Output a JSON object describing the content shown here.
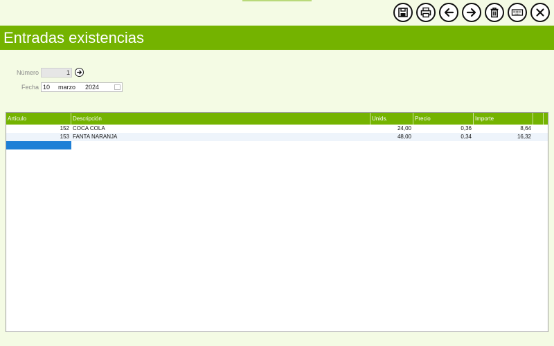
{
  "toolbar": {
    "buttons": [
      {
        "icon": "save-icon"
      },
      {
        "icon": "print-icon"
      },
      {
        "icon": "arrow-left-icon"
      },
      {
        "icon": "arrow-right-icon"
      },
      {
        "icon": "trash-icon"
      },
      {
        "icon": "keyboard-icon"
      },
      {
        "icon": "close-icon"
      }
    ]
  },
  "header": {
    "title": "Entradas existencias"
  },
  "form": {
    "numero_label": "Número",
    "numero_value": "1",
    "fecha_label": "Fecha",
    "fecha_day": "10",
    "fecha_month": "marzo",
    "fecha_year": "2024"
  },
  "grid": {
    "columns": [
      "Artículo",
      "Descripción",
      "Unids.",
      "Precio",
      "Importe"
    ],
    "rows": [
      {
        "articulo": "152",
        "descripcion": "COCA COLA",
        "unids": "24,00",
        "precio": "0,36",
        "importe": "8,64"
      },
      {
        "articulo": "153",
        "descripcion": "FANTA NARANJA",
        "unids": "48,00",
        "precio": "0,34",
        "importe": "16,32"
      }
    ]
  },
  "colors": {
    "brand_green": "#74b300",
    "selection_blue": "#1e7fd6",
    "background": "#f4fbe4"
  }
}
